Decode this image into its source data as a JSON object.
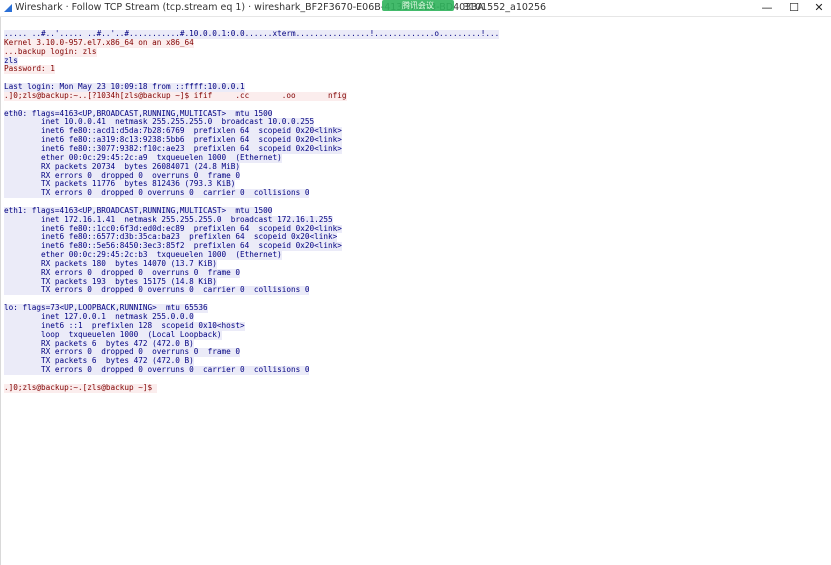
{
  "window": {
    "title": "Wireshark · Follow TCP Stream (tcp.stream eq 1) · wireshark_BF2F3670-E06B-4138-A3E3-BD4033A",
    "title_suffix": "3101552_a10256",
    "overlay_badge": "腾讯会议",
    "minimize_glyph": "—",
    "maximize_glyph": "☐",
    "close_glyph": "✕"
  },
  "stream": {
    "lines": [
      {
        "t": "..... ..#..'..... ..#..'..#...........#.10.0.0.1:0.0......xterm................!.............o.........!...",
        "k": "c"
      },
      {
        "t": "Kernel 3.10.0-957.el7.x86_64 on an x86_64",
        "k": "s"
      },
      {
        "t": "...backup login: zls",
        "k": "s"
      },
      {
        "t": "zls",
        "k": "c"
      },
      {
        "t": "Password: 1",
        "k": "s"
      },
      {
        "t": "",
        "k": "s"
      },
      {
        "t": "Last login: Mon May 23 10:09:18 from ::ffff:10.0.0.1",
        "k": "c"
      },
      {
        "t": ".]0;zls@backup:~..[?1034h[zls@backup ~]$ ifif     .cc       .oo       nfig",
        "k": "s"
      },
      {
        "t": "",
        "k": "c"
      },
      {
        "t": "eth0: flags=4163<UP,BROADCAST,RUNNING,MULTICAST>  mtu 1500",
        "k": "c"
      },
      {
        "t": "        inet 10.0.0.41  netmask 255.255.255.0  broadcast 10.0.0.255",
        "k": "c"
      },
      {
        "t": "        inet6 fe80::acd1:d5da:7b28:6769  prefixlen 64  scopeid 0x20<link>",
        "k": "c"
      },
      {
        "t": "        inet6 fe80::a319:8c13:9238:5bb6  prefixlen 64  scopeid 0x20<link>",
        "k": "c"
      },
      {
        "t": "        inet6 fe80::3077:9382:f10c:ae23  prefixlen 64  scopeid 0x20<link>",
        "k": "c"
      },
      {
        "t": "        ether 00:0c:29:45:2c:a9  txqueuelen 1000  (Ethernet)",
        "k": "c"
      },
      {
        "t": "        RX packets 20734  bytes 26084071 (24.8 MiB)",
        "k": "c"
      },
      {
        "t": "        RX errors 0  dropped 0  overruns 0  frame 0",
        "k": "c"
      },
      {
        "t": "        TX packets 11776  bytes 812436 (793.3 KiB)",
        "k": "c"
      },
      {
        "t": "        TX errors 0  dropped 0 overruns 0  carrier 0  collisions 0",
        "k": "c"
      },
      {
        "t": "",
        "k": "c"
      },
      {
        "t": "eth1: flags=4163<UP,BROADCAST,RUNNING,MULTICAST>  mtu 1500",
        "k": "c"
      },
      {
        "t": "        inet 172.16.1.41  netmask 255.255.255.0  broadcast 172.16.1.255",
        "k": "c"
      },
      {
        "t": "        inet6 fe80::1cc0:6f3d:ed0d:ec89  prefixlen 64  scopeid 0x20<link>",
        "k": "c"
      },
      {
        "t": "        inet6 fe80::6577:d3b:35ca:ba23  prefixlen 64  scopeid 0x20<link>",
        "k": "c"
      },
      {
        "t": "        inet6 fe80::5e56:8450:3ec3:85f2  prefixlen 64  scopeid 0x20<link>",
        "k": "c"
      },
      {
        "t": "        ether 00:0c:29:45:2c:b3  txqueuelen 1000  (Ethernet)",
        "k": "c"
      },
      {
        "t": "        RX packets 180  bytes 14070 (13.7 KiB)",
        "k": "c"
      },
      {
        "t": "        RX errors 0  dropped 0  overruns 0  frame 0",
        "k": "c"
      },
      {
        "t": "        TX packets 193  bytes 15175 (14.8 KiB)",
        "k": "c"
      },
      {
        "t": "        TX errors 0  dropped 0 overruns 0  carrier 0  collisions 0",
        "k": "c"
      },
      {
        "t": "",
        "k": "c"
      },
      {
        "t": "lo: flags=73<UP,LOOPBACK,RUNNING>  mtu 65536",
        "k": "c"
      },
      {
        "t": "        inet 127.0.0.1  netmask 255.0.0.0",
        "k": "c"
      },
      {
        "t": "        inet6 ::1  prefixlen 128  scopeid 0x10<host>",
        "k": "c"
      },
      {
        "t": "        loop  txqueuelen 1000  (Local Loopback)",
        "k": "c"
      },
      {
        "t": "        RX packets 6  bytes 472 (472.0 B)",
        "k": "c"
      },
      {
        "t": "        RX errors 0  dropped 0  overruns 0  frame 0",
        "k": "c"
      },
      {
        "t": "        TX packets 6  bytes 472 (472.0 B)",
        "k": "c"
      },
      {
        "t": "        TX errors 0  dropped 0 overruns 0  carrier 0  collisions 0",
        "k": "c"
      },
      {
        "t": "",
        "k": "c"
      },
      {
        "t": ".]0;zls@backup:~.[zls@backup ~]$ ",
        "k": "s"
      }
    ]
  },
  "colors": {
    "client_text": "#000080",
    "client_bg": "#ebebf8",
    "server_text": "#800000",
    "server_bg": "#fbeded",
    "app_icon": "#2a6fd6"
  },
  "icons": {
    "app_icon": "wireshark-fin-icon"
  }
}
